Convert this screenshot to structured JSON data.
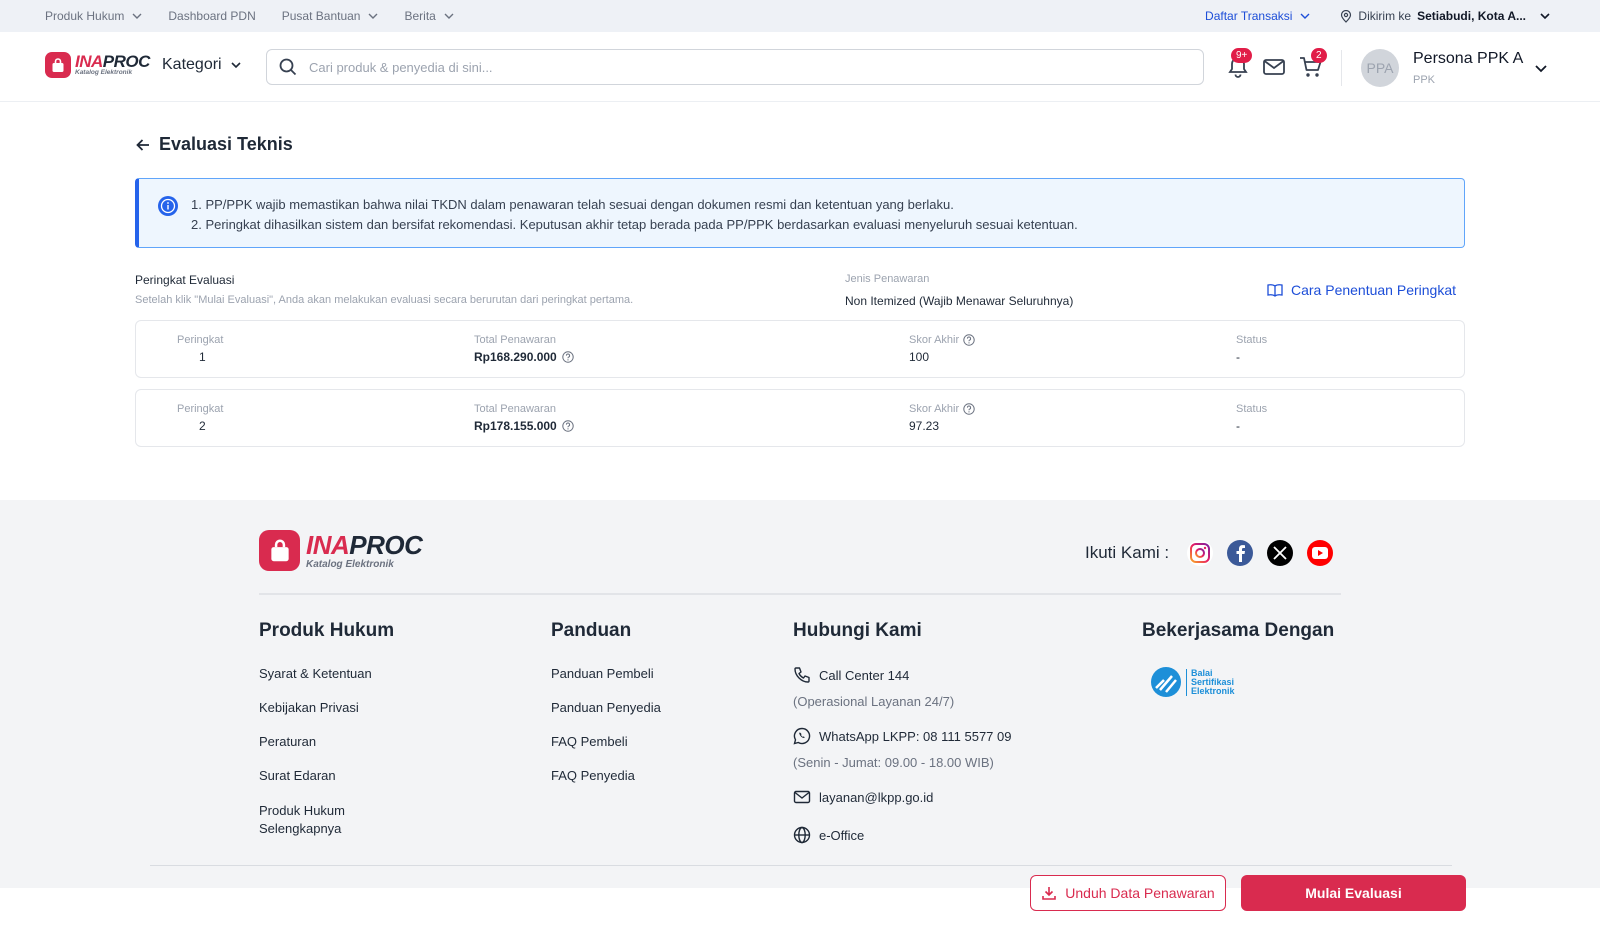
{
  "utilbar": {
    "links": [
      "Produk Hukum",
      "Dashboard PDN",
      "Pusat Bantuan",
      "Berita"
    ],
    "daftar_transaksi": "Daftar Transaksi",
    "dikirim_ke_label": "Dikirim ke",
    "dikirim_ke_value": "Setiabudi, Kota A..."
  },
  "header": {
    "logo_main_ina": "INA",
    "logo_main_proc": "PROC",
    "logo_sub": "Katalog Elektronik",
    "kategori": "Kategori",
    "search_placeholder": "Cari produk & penyedia di sini...",
    "notif_badge": "9+",
    "cart_badge": "2",
    "avatar_initials": "PPA",
    "user_name": "Persona PPK A",
    "user_role": "PPK"
  },
  "main": {
    "title": "Evaluasi Teknis",
    "info": [
      "1. PP/PPK wajib memastikan bahwa nilai TKDN dalam penawaran telah sesuai dengan dokumen resmi dan ketentuan yang berlaku.",
      "2. Peringkat dihasilkan sistem dan bersifat rekomendasi. Keputusan akhir tetap berada pada PP/PPK berdasarkan evaluasi menyeluruh sesuai ketentuan."
    ],
    "section_title": "Peringkat Evaluasi",
    "section_desc": "Setelah klik \"Mulai Evaluasi\", Anda akan melakukan evaluasi secara berurutan dari peringkat pertama.",
    "jenis_label": "Jenis Penawaran",
    "jenis_value": "Non Itemized (Wajib Menawar Seluruhnya)",
    "cara_link": "Cara Penentuan Peringkat",
    "col_labels": {
      "peringkat": "Peringkat",
      "total": "Total Penawaran",
      "skor": "Skor Akhir",
      "status": "Status"
    },
    "rows": [
      {
        "peringkat": "1",
        "total": "Rp168.290.000",
        "skor": "100",
        "status": "-"
      },
      {
        "peringkat": "2",
        "total": "Rp178.155.000",
        "skor": "97.23",
        "status": "-"
      }
    ]
  },
  "footer": {
    "logo_main_ina": "INA",
    "logo_main_proc": "PROC",
    "logo_sub": "Katalog Elektronik",
    "ikuti": "Ikuti Kami :",
    "produk_hukum": {
      "title": "Produk Hukum",
      "items": [
        "Syarat & Ketentuan",
        "Kebijakan Privasi",
        "Peraturan",
        "Surat Edaran",
        "Produk Hukum Selengkapnya"
      ]
    },
    "panduan": {
      "title": "Panduan",
      "items": [
        "Panduan Pembeli",
        "Panduan Penyedia",
        "FAQ Pembeli",
        "FAQ Penyedia"
      ]
    },
    "hubungi": {
      "title": "Hubungi Kami",
      "call": "Call Center 144",
      "call_note": "(Operasional Layanan 24/7)",
      "wa": "WhatsApp LKPP: 08 111 5577 09",
      "wa_note": "(Senin - Jumat: 09.00 - 18.00 WIB)",
      "email": "layanan@lkpp.go.id",
      "office": "e-Office"
    },
    "kerjasama": {
      "title": "Bekerjasama Dengan",
      "partner_line1": "Balai",
      "partner_line2": "Sertifikasi",
      "partner_line3": "Elektronik"
    }
  },
  "actions": {
    "unduh": "Unduh Data Penawaran",
    "mulai": "Mulai Evaluasi"
  },
  "colors": {
    "brand": "#d92b4f",
    "link": "#1d4ed8",
    "info_bg": "#eef6fe"
  }
}
